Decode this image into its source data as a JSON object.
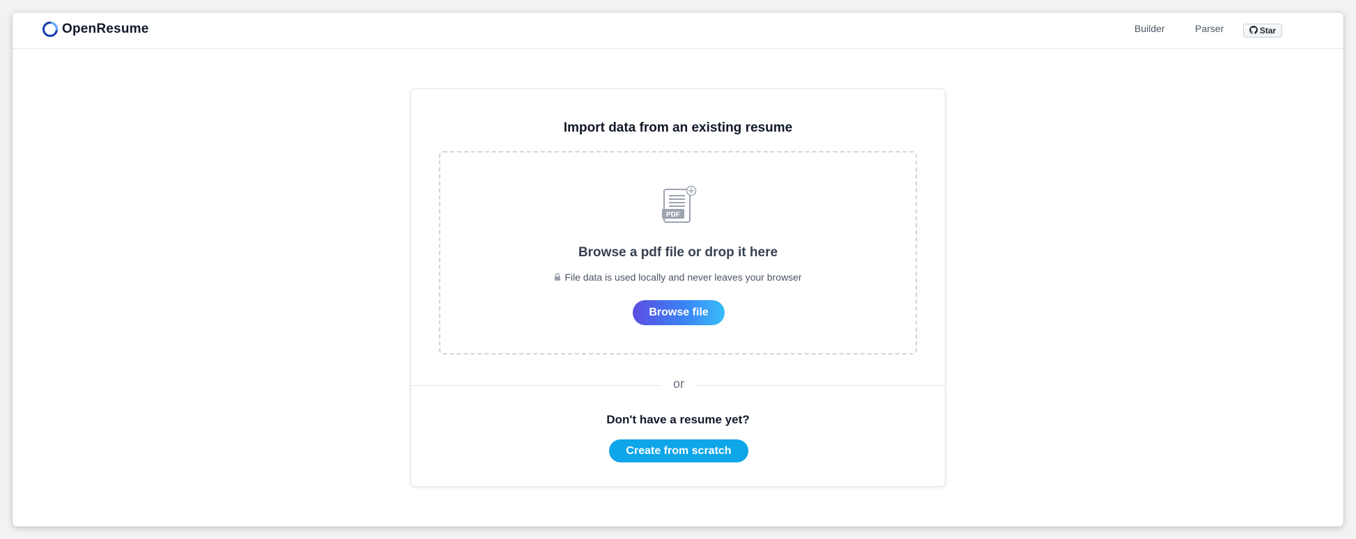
{
  "app": {
    "name": "OpenResume",
    "logo_icon": "open-ring-logo-icon"
  },
  "nav": {
    "builder": "Builder",
    "parser": "Parser",
    "github_star": "Star",
    "github_icon": "github-icon"
  },
  "import": {
    "title": "Import data from an existing resume",
    "pdf_icon": "pdf-file-add-icon",
    "pdf_badge": "PDF",
    "dropzone_title": "Browse a pdf file or drop it here",
    "privacy_icon": "lock-icon",
    "privacy_note": "File data is used locally and never leaves your browser",
    "browse_button": "Browse file"
  },
  "divider_text": "or",
  "scratch": {
    "title": "Don't have a resume yet?",
    "button": "Create from scratch"
  },
  "colors": {
    "primary": "#0ea5e9",
    "gradient_start": "#5b4ee0",
    "gradient_end": "#38bdf8",
    "logo_dark": "#1e40af",
    "logo_light": "#60a5fa"
  }
}
